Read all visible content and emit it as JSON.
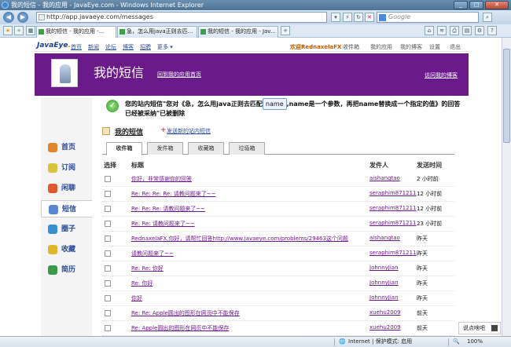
{
  "browser": {
    "title": "我的短信 - 我的应用 - JavaEye.com - Windows Internet Explorer",
    "url": "http://app.javaeye.com/messages",
    "search_placeholder": "Google",
    "tabs": [
      {
        "label": "我的短信 - 我的应用 -..."
      },
      {
        "label": "急，怎么用java正则去匹..."
      },
      {
        "label": "我的短信 - 我的应用 - Jav..."
      }
    ]
  },
  "site": {
    "logo_main": "JavaEye",
    "logo_dot": ".",
    "nav": [
      "首页",
      "新闻",
      "论坛",
      "博客",
      "招聘",
      "更多 ▾"
    ],
    "right_links": [
      "欢迎RednaxelaFX",
      "收件箱",
      "我的应用",
      "我的博客",
      "设置",
      "退出"
    ]
  },
  "banner": {
    "title": "我的短信",
    "back_link": "回到我的应用首页",
    "right_link": "访问我的博客"
  },
  "sidebar": {
    "items": [
      {
        "label": "首页",
        "icon": "home-icon",
        "color": "#e0852c"
      },
      {
        "label": "订阅",
        "icon": "subscribe-icon",
        "color": "#d8c43c"
      },
      {
        "label": "闲聊",
        "icon": "chat-icon",
        "color": "#e05a2c"
      },
      {
        "label": "短信",
        "icon": "message-icon",
        "color": "#5a85d6"
      },
      {
        "label": "圈子",
        "icon": "group-icon",
        "color": "#3a8fd0"
      },
      {
        "label": "收藏",
        "icon": "star-icon",
        "color": "#e2b52e"
      },
      {
        "label": "简历",
        "icon": "resume-icon",
        "color": "#3a9a4a"
      }
    ],
    "active_index": 3
  },
  "notice": {
    "line1_before": "您的站内短信\"您对《急，怎么用java正则去匹配",
    "name_tag": "name",
    "line1_after": ",name是一个参数，再把name替换成一个指定的值》的回答",
    "line2": "已经被采纳\"已被删除"
  },
  "messages_header": {
    "title": "我的短信",
    "new_link": "发送新的站内短信"
  },
  "mail_tabs": [
    "收件箱",
    "发件箱",
    "收藏箱",
    "垃圾箱"
  ],
  "columns": {
    "select": "选择",
    "title": "标题",
    "sender": "发件人",
    "time": "发送时间"
  },
  "rows": [
    {
      "title": "你好，非常感谢你的回答",
      "sender": "aishangtao",
      "time": "2 小时前"
    },
    {
      "title": "Re: Re: Re: Re: 请教问题来了~~",
      "sender": "seraphim871211",
      "time": "12 小时前"
    },
    {
      "title": "Re: Re: Re: 请教问题来了~~",
      "sender": "seraphim871211",
      "time": "12 小时前"
    },
    {
      "title": "Re: Re: 请教问题来了~~",
      "sender": "seraphim871211",
      "time": "23 小时前"
    },
    {
      "title": "RednaxelaFX,你好，请帮忙回答http://www.javaeye.com/problems/29463这个问题",
      "sender": "aishangtao",
      "time": "昨天"
    },
    {
      "title": "请教问题来了~~",
      "sender": "seraphim871211",
      "time": "昨天"
    },
    {
      "title": "Re: Re: 你好",
      "sender": "JohnnyJian",
      "time": "昨天"
    },
    {
      "title": "Re: 你好",
      "sender": "JohnnyJian",
      "time": "昨天"
    },
    {
      "title": "你好",
      "sender": "JohnnyJian",
      "time": "昨天"
    },
    {
      "title": "Re: Re: Apple圆出的图形在网页中不能保存",
      "sender": "xuehu2009",
      "time": "前天"
    },
    {
      "title": "Re: Apple圆出的图形在网页中不能保存",
      "sender": "xuehu2009",
      "time": "前天"
    }
  ],
  "promo": {
    "label": "说点啥吧"
  },
  "status": {
    "zone": "Internet | 保护模式: 启用",
    "zoom": "100%"
  }
}
